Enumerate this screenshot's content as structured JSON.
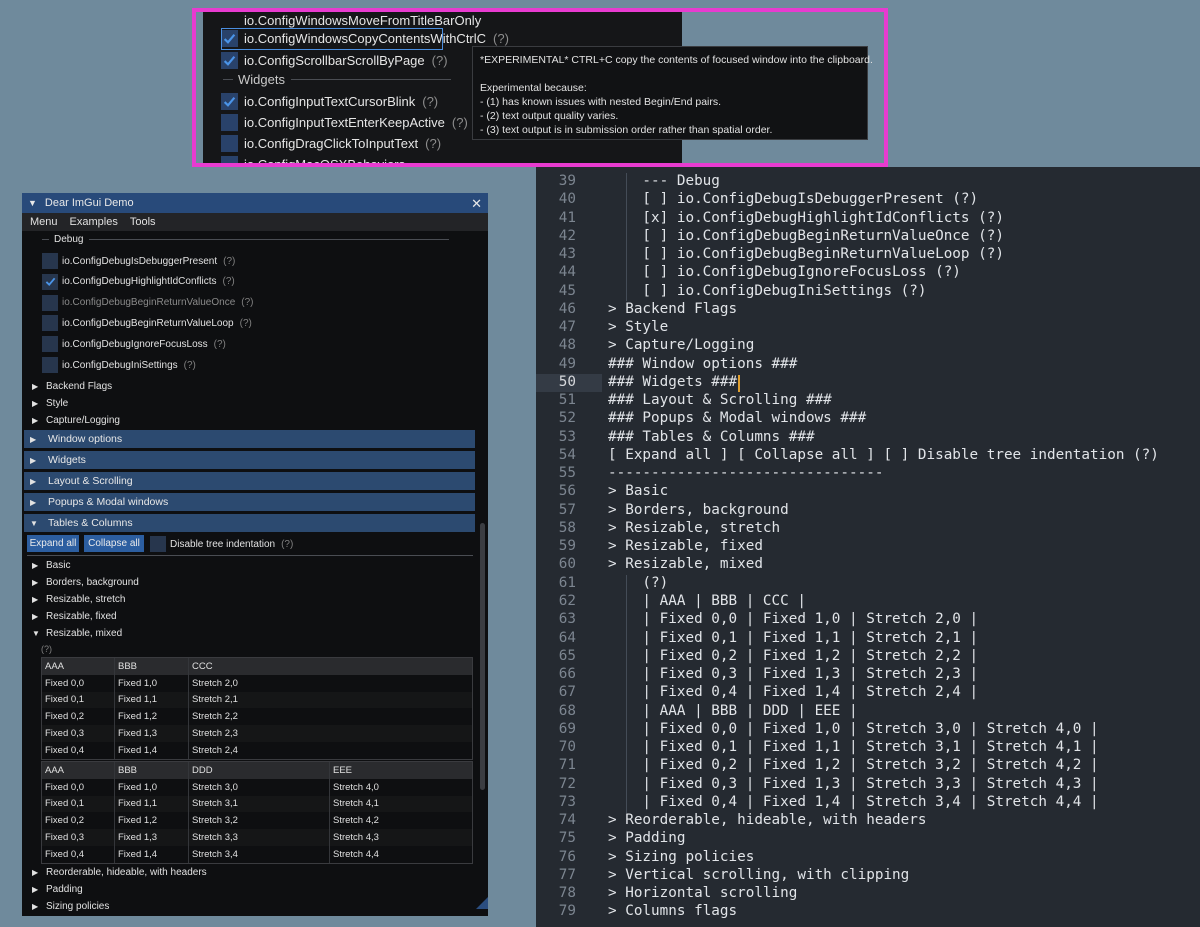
{
  "colors": {
    "accent": "#e83bd0",
    "check": "#4a94e8",
    "caret": "#e0a030"
  },
  "top_panel": {
    "rows": [
      {
        "label": "io.ConfigWindowsMoveFromTitleBarOnly",
        "checked": null,
        "help": ""
      },
      {
        "label": "io.ConfigWindowsCopyContentsWithCtrlC",
        "checked": true,
        "help": "(?)"
      },
      {
        "label": "io.ConfigScrollbarScrollByPage",
        "checked": true,
        "help": "(?)"
      },
      {
        "label": "io.ConfigInputTextCursorBlink",
        "checked": true,
        "help": "(?)"
      },
      {
        "label": "io.ConfigInputTextEnterKeepActive",
        "checked": false,
        "help": "(?)"
      },
      {
        "label": "io.ConfigDragClickToInputText",
        "checked": false,
        "help": "(?)"
      },
      {
        "label": "io.ConfigMacOSXBehaviors",
        "checked": false,
        "help": ""
      }
    ],
    "separator": "Widgets",
    "tooltip": [
      "*EXPERIMENTAL* CTRL+C copy the contents of focused window into the clipboard.",
      "",
      "Experimental because:",
      "- (1) has known issues with nested Begin/End pairs.",
      "- (2) text output quality varies.",
      "- (3) text output is in submission order rather than spatial order."
    ]
  },
  "imgui": {
    "title": "Dear ImGui Demo",
    "close_glyph": "✕",
    "menu": [
      "Menu",
      "Examples",
      "Tools"
    ],
    "debug_separator": "Debug",
    "debug_items": [
      {
        "label": "io.ConfigDebugIsDebuggerPresent",
        "checked": false,
        "disabled": false,
        "help": "(?)"
      },
      {
        "label": "io.ConfigDebugHighlightIdConflicts",
        "checked": true,
        "disabled": false,
        "help": "(?)"
      },
      {
        "label": "io.ConfigDebugBeginReturnValueOnce",
        "checked": false,
        "disabled": true,
        "help": "(?)"
      },
      {
        "label": "io.ConfigDebugBeginReturnValueLoop",
        "checked": false,
        "disabled": false,
        "help": "(?)"
      },
      {
        "label": "io.ConfigDebugIgnoreFocusLoss",
        "checked": false,
        "disabled": false,
        "help": "(?)"
      },
      {
        "label": "io.ConfigDebugIniSettings",
        "checked": false,
        "disabled": false,
        "help": "(?)"
      }
    ],
    "sub_nodes": [
      "Backend Flags",
      "Style",
      "Capture/Logging"
    ],
    "headers": [
      "Window options",
      "Widgets",
      "Layout & Scrolling",
      "Popups & Modal windows",
      "Tables & Columns"
    ],
    "expand_all": "Expand all",
    "collapse_all": "Collapse all",
    "disable_indent": "Disable tree indentation",
    "help": "(?)",
    "tree_nodes": [
      "Basic",
      "Borders, background",
      "Resizable, stretch",
      "Resizable, fixed",
      "Resizable, mixed"
    ],
    "mixed_help": "(?)",
    "table1": {
      "headers": [
        "AAA",
        "BBB",
        "CCC"
      ],
      "rows": [
        [
          "Fixed 0,0",
          "Fixed 1,0",
          "Stretch 2,0"
        ],
        [
          "Fixed 0,1",
          "Fixed 1,1",
          "Stretch 2,1"
        ],
        [
          "Fixed 0,2",
          "Fixed 1,2",
          "Stretch 2,2"
        ],
        [
          "Fixed 0,3",
          "Fixed 1,3",
          "Stretch 2,3"
        ],
        [
          "Fixed 0,4",
          "Fixed 1,4",
          "Stretch 2,4"
        ]
      ]
    },
    "table2": {
      "headers": [
        "AAA",
        "BBB",
        "DDD",
        "EEE"
      ],
      "rows": [
        [
          "Fixed 0,0",
          "Fixed 1,0",
          "Stretch 3,0",
          "Stretch 4,0"
        ],
        [
          "Fixed 0,1",
          "Fixed 1,1",
          "Stretch 3,1",
          "Stretch 4,1"
        ],
        [
          "Fixed 0,2",
          "Fixed 1,2",
          "Stretch 3,2",
          "Stretch 4,2"
        ],
        [
          "Fixed 0,3",
          "Fixed 1,3",
          "Stretch 3,3",
          "Stretch 4,3"
        ],
        [
          "Fixed 0,4",
          "Fixed 1,4",
          "Stretch 3,4",
          "Stretch 4,4"
        ]
      ]
    },
    "trailing_nodes": [
      "Reorderable, hideable, with headers",
      "Padding",
      "Sizing policies"
    ]
  },
  "editor": {
    "current_line": 50,
    "lines": [
      {
        "n": 39,
        "text": "    --- Debug"
      },
      {
        "n": 40,
        "text": "    [ ] io.ConfigDebugIsDebuggerPresent (?)"
      },
      {
        "n": 41,
        "text": "    [x] io.ConfigDebugHighlightIdConflicts (?)"
      },
      {
        "n": 42,
        "text": "    [ ] io.ConfigDebugBeginReturnValueOnce (?)"
      },
      {
        "n": 43,
        "text": "    [ ] io.ConfigDebugBeginReturnValueLoop (?)"
      },
      {
        "n": 44,
        "text": "    [ ] io.ConfigDebugIgnoreFocusLoss (?)"
      },
      {
        "n": 45,
        "text": "    [ ] io.ConfigDebugIniSettings (?)"
      },
      {
        "n": 46,
        "text": "> Backend Flags"
      },
      {
        "n": 47,
        "text": "> Style"
      },
      {
        "n": 48,
        "text": "> Capture/Logging"
      },
      {
        "n": 49,
        "text": "### Window options ###"
      },
      {
        "n": 50,
        "text": "### Widgets ###"
      },
      {
        "n": 51,
        "text": "### Layout & Scrolling ###"
      },
      {
        "n": 52,
        "text": "### Popups & Modal windows ###"
      },
      {
        "n": 53,
        "text": "### Tables & Columns ###"
      },
      {
        "n": 54,
        "text": "[ Expand all ] [ Collapse all ] [ ] Disable tree indentation (?)"
      },
      {
        "n": 55,
        "text": "--------------------------------"
      },
      {
        "n": 56,
        "text": "> Basic"
      },
      {
        "n": 57,
        "text": "> Borders, background"
      },
      {
        "n": 58,
        "text": "> Resizable, stretch"
      },
      {
        "n": 59,
        "text": "> Resizable, fixed"
      },
      {
        "n": 60,
        "text": "> Resizable, mixed"
      },
      {
        "n": 61,
        "text": "    (?)"
      },
      {
        "n": 62,
        "text": "    | AAA | BBB | CCC |"
      },
      {
        "n": 63,
        "text": "    | Fixed 0,0 | Fixed 1,0 | Stretch 2,0 |"
      },
      {
        "n": 64,
        "text": "    | Fixed 0,1 | Fixed 1,1 | Stretch 2,1 |"
      },
      {
        "n": 65,
        "text": "    | Fixed 0,2 | Fixed 1,2 | Stretch 2,2 |"
      },
      {
        "n": 66,
        "text": "    | Fixed 0,3 | Fixed 1,3 | Stretch 2,3 |"
      },
      {
        "n": 67,
        "text": "    | Fixed 0,4 | Fixed 1,4 | Stretch 2,4 |"
      },
      {
        "n": 68,
        "text": "    | AAA | BBB | DDD | EEE |"
      },
      {
        "n": 69,
        "text": "    | Fixed 0,0 | Fixed 1,0 | Stretch 3,0 | Stretch 4,0 |"
      },
      {
        "n": 70,
        "text": "    | Fixed 0,1 | Fixed 1,1 | Stretch 3,1 | Stretch 4,1 |"
      },
      {
        "n": 71,
        "text": "    | Fixed 0,2 | Fixed 1,2 | Stretch 3,2 | Stretch 4,2 |"
      },
      {
        "n": 72,
        "text": "    | Fixed 0,3 | Fixed 1,3 | Stretch 3,3 | Stretch 4,3 |"
      },
      {
        "n": 73,
        "text": "    | Fixed 0,4 | Fixed 1,4 | Stretch 3,4 | Stretch 4,4 |"
      },
      {
        "n": 74,
        "text": "> Reorderable, hideable, with headers"
      },
      {
        "n": 75,
        "text": "> Padding"
      },
      {
        "n": 76,
        "text": "> Sizing policies"
      },
      {
        "n": 77,
        "text": "> Vertical scrolling, with clipping"
      },
      {
        "n": 78,
        "text": "> Horizontal scrolling"
      },
      {
        "n": 79,
        "text": "> Columns flags"
      }
    ]
  }
}
